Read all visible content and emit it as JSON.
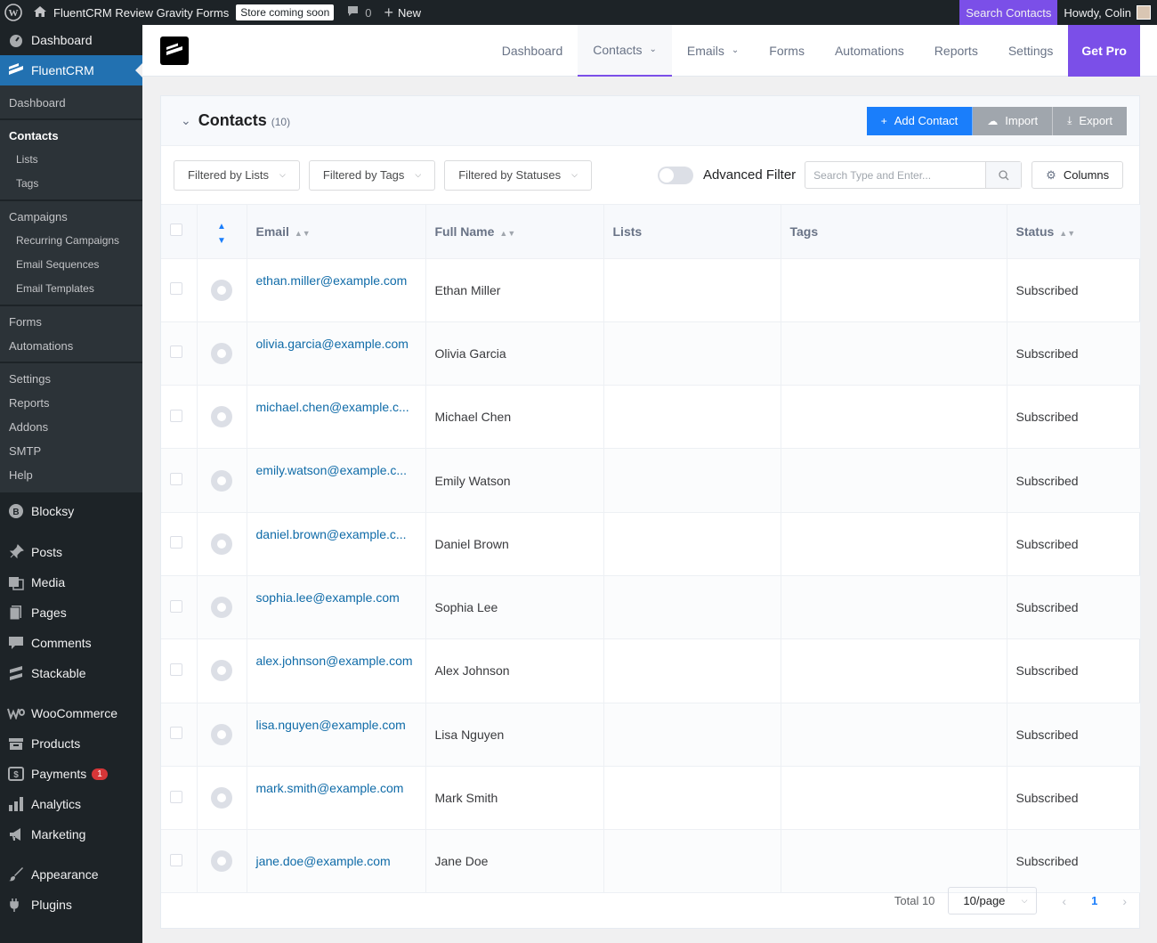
{
  "adminbar": {
    "site_name": "FluentCRM Review Gravity Forms",
    "store_badge": "Store coming soon",
    "comments_count": "0",
    "new_label": "New",
    "search_contacts": "Search Contacts",
    "howdy": "Howdy, Colin"
  },
  "sidebar": {
    "dashboard": "Dashboard",
    "fluentcrm": "FluentCRM",
    "sub": {
      "dashboard": "Dashboard",
      "contacts": "Contacts",
      "lists": "Lists",
      "tags": "Tags",
      "campaigns": "Campaigns",
      "recurring": "Recurring Campaigns",
      "sequences": "Email Sequences",
      "templates": "Email Templates",
      "forms": "Forms",
      "automations": "Automations",
      "settings": "Settings",
      "reports": "Reports",
      "addons": "Addons",
      "smtp": "SMTP",
      "help": "Help"
    },
    "blocksy": "Blocksy",
    "posts": "Posts",
    "media": "Media",
    "pages": "Pages",
    "comments": "Comments",
    "stackable": "Stackable",
    "woocommerce": "WooCommerce",
    "products": "Products",
    "payments": "Payments",
    "payments_badge": "1",
    "analytics": "Analytics",
    "marketing": "Marketing",
    "appearance": "Appearance",
    "plugins": "Plugins"
  },
  "topnav": {
    "dashboard": "Dashboard",
    "contacts": "Contacts",
    "emails": "Emails",
    "forms": "Forms",
    "automations": "Automations",
    "reports": "Reports",
    "settings": "Settings",
    "get_pro": "Get Pro"
  },
  "card": {
    "title": "Contacts",
    "count": "(10)",
    "add_contact": "Add Contact",
    "import": "Import",
    "export": "Export"
  },
  "filters": {
    "lists": "Filtered by Lists",
    "tags": "Filtered by Tags",
    "statuses": "Filtered by Statuses",
    "advanced": "Advanced Filter",
    "search_placeholder": "Search Type and Enter...",
    "columns": "Columns"
  },
  "table": {
    "headers": {
      "email": "Email",
      "full_name": "Full Name",
      "lists": "Lists",
      "tags": "Tags",
      "status": "Status"
    },
    "rows": [
      {
        "email": "ethan.miller@example.com",
        "name": "Ethan Miller",
        "status": "Subscribed"
      },
      {
        "email": "olivia.garcia@example.com",
        "name": "Olivia Garcia",
        "status": "Subscribed"
      },
      {
        "email": "michael.chen@example.c...",
        "name": "Michael Chen",
        "status": "Subscribed"
      },
      {
        "email": "emily.watson@example.c...",
        "name": "Emily Watson",
        "status": "Subscribed"
      },
      {
        "email": "daniel.brown@example.c...",
        "name": "Daniel Brown",
        "status": "Subscribed"
      },
      {
        "email": "sophia.lee@example.com",
        "name": "Sophia Lee",
        "status": "Subscribed"
      },
      {
        "email": "alex.johnson@example.com",
        "name": "Alex Johnson",
        "status": "Subscribed"
      },
      {
        "email": "lisa.nguyen@example.com",
        "name": "Lisa Nguyen",
        "status": "Subscribed"
      },
      {
        "email": "mark.smith@example.com",
        "name": "Mark Smith",
        "status": "Subscribed"
      },
      {
        "email": "jane.doe@example.com",
        "name": "Jane Doe",
        "status": "Subscribed"
      }
    ]
  },
  "pagination": {
    "total": "Total 10",
    "per_page": "10/page",
    "current_page": "1"
  },
  "colors": {
    "accent": "#7b4fe8",
    "primary": "#1a7efb",
    "wp_dark": "#1d2327",
    "wp_blue": "#2271b1"
  }
}
